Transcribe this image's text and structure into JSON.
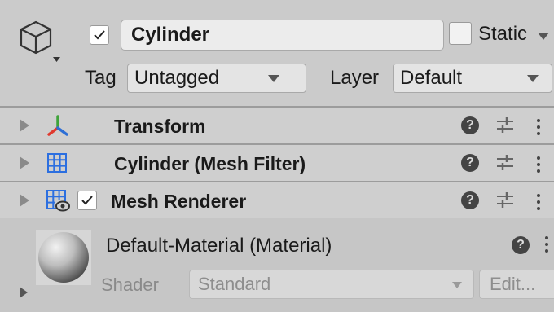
{
  "header": {
    "active_checked": true,
    "object_name": "Cylinder",
    "static_label": "Static",
    "static_checked": false,
    "tag_label": "Tag",
    "tag_value": "Untagged",
    "layer_label": "Layer",
    "layer_value": "Default"
  },
  "components": [
    {
      "title": "Transform",
      "icon": "transform-axes-icon",
      "has_enable_checkbox": false
    },
    {
      "title": "Cylinder (Mesh Filter)",
      "icon": "mesh-filter-grid-icon",
      "has_enable_checkbox": false
    },
    {
      "title": "Mesh Renderer",
      "icon": "mesh-renderer-icon",
      "has_enable_checkbox": true,
      "enabled": true
    }
  ],
  "help_glyph": "?",
  "material": {
    "name": "Default-Material (Material)",
    "shader_label": "Shader",
    "shader_value": "Standard",
    "edit_label": "Edit..."
  },
  "colors": {
    "transform_red": "#e03a2f",
    "transform_green": "#3fa33a",
    "transform_blue": "#2d6fd6",
    "grid_blue": "#2c6fe0"
  }
}
